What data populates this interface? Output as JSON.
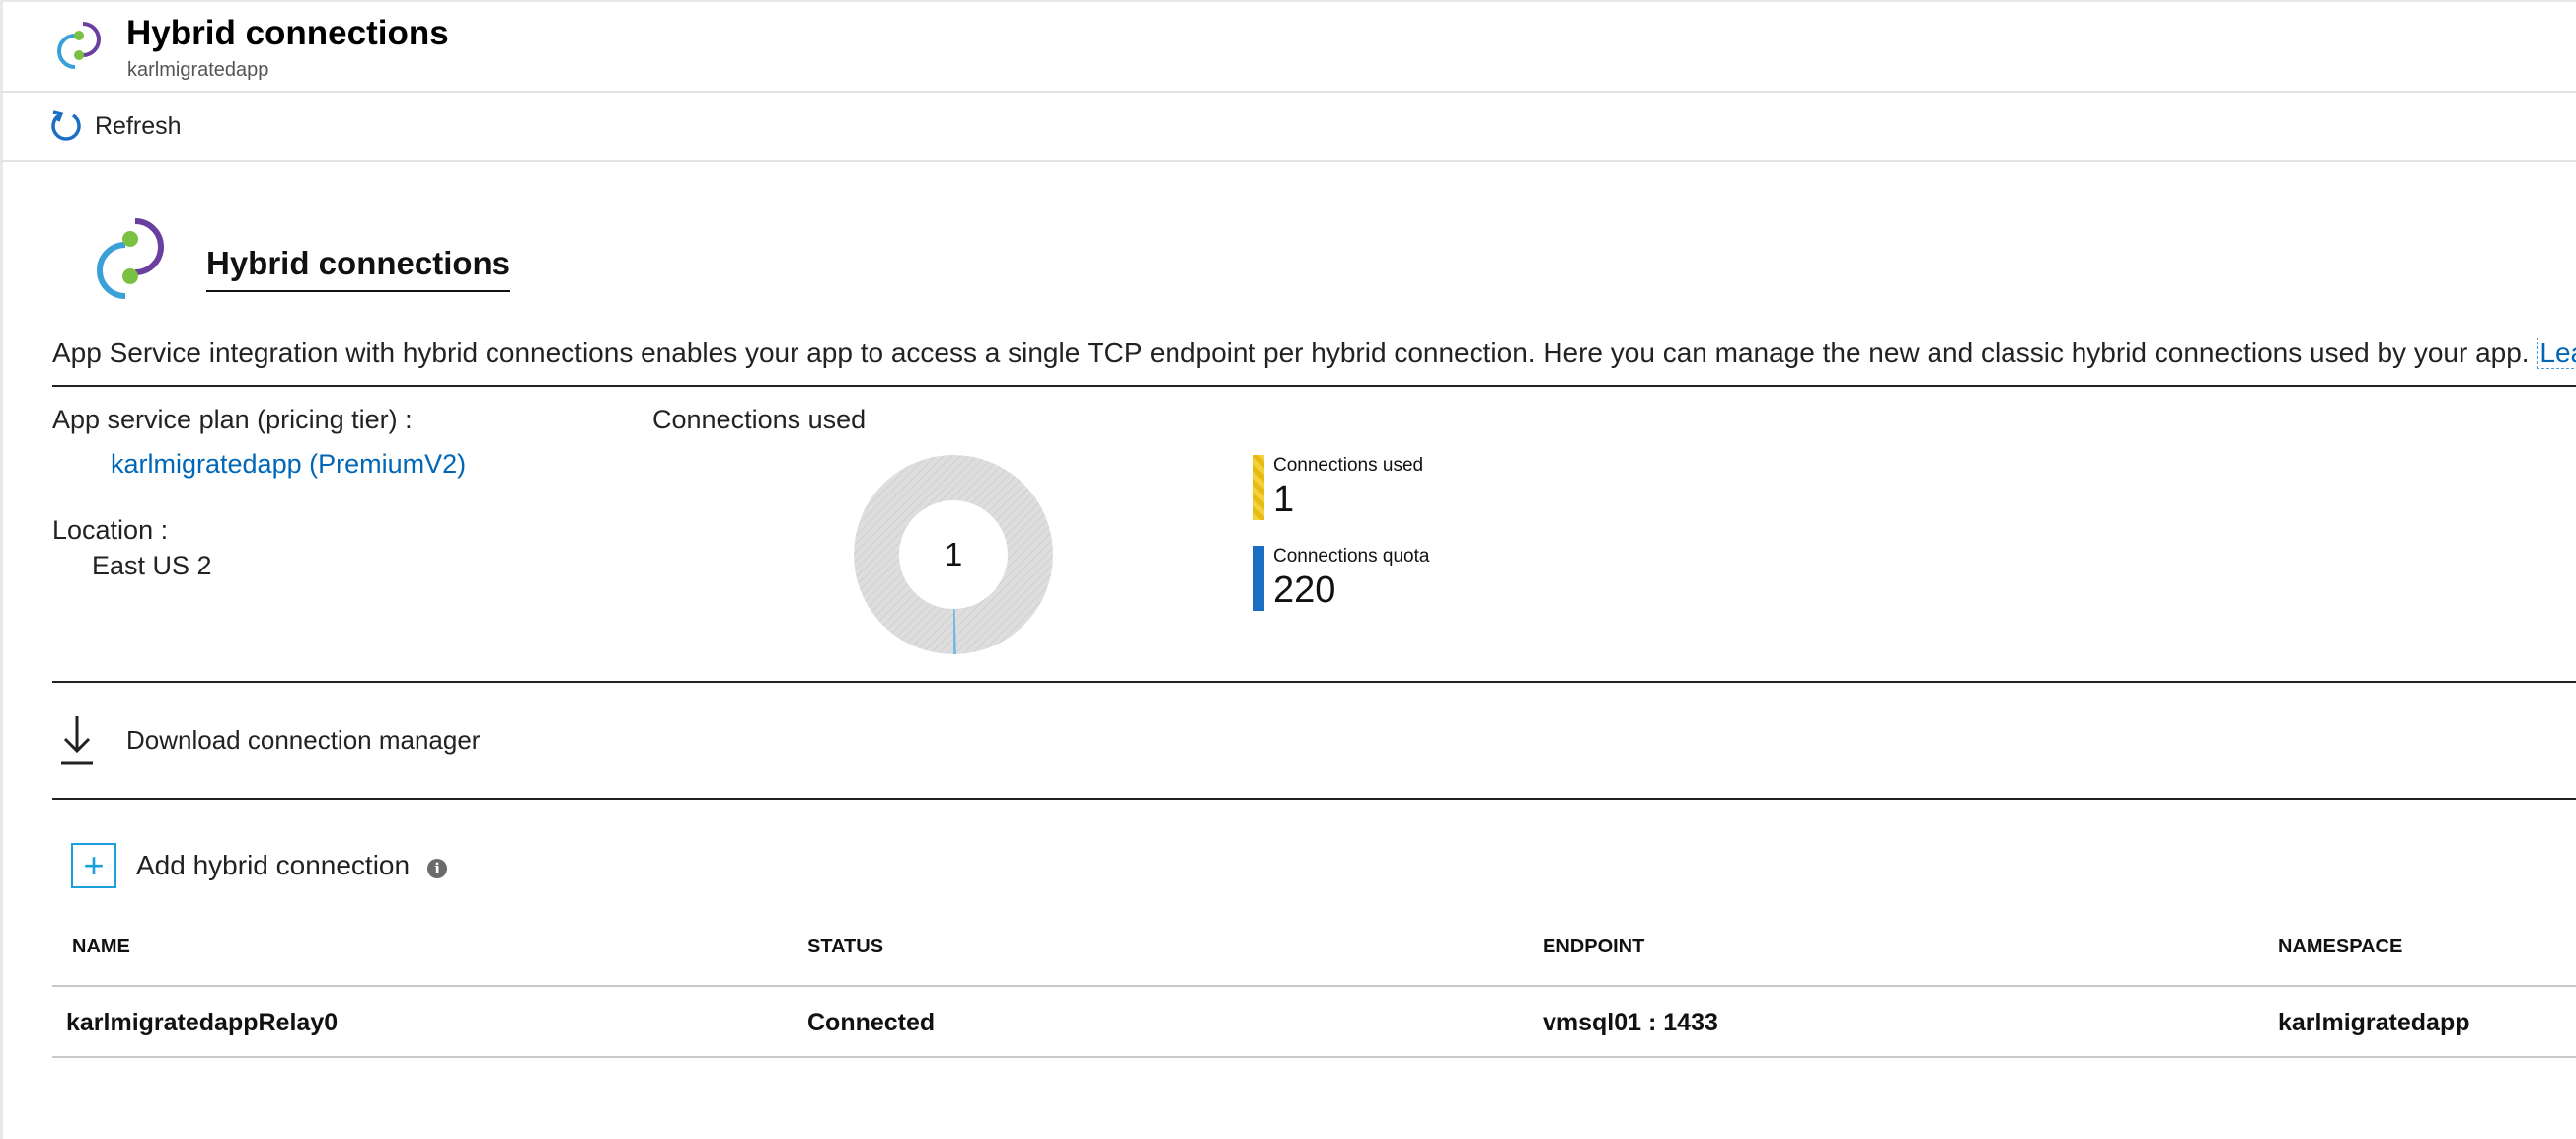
{
  "header": {
    "title": "Hybrid connections",
    "subtitle": "karlmigratedapp"
  },
  "toolbar": {
    "refresh_label": "Refresh"
  },
  "hero": {
    "title": "Hybrid connections"
  },
  "description": {
    "text": "App Service integration with hybrid connections enables your app to access a single TCP endpoint per hybrid connection. Here you can manage the new and classic hybrid connections used by your app. ",
    "link_text": "Learn more"
  },
  "info": {
    "plan_label": "App service plan (pricing tier) :",
    "plan_value": "karlmigratedapp (PremiumV2)",
    "location_label": "Location :",
    "location_value": "East US 2"
  },
  "connections": {
    "title": "Connections used",
    "center_value": "1",
    "used": 1,
    "quota": 220,
    "legend": [
      {
        "label": "Connections used",
        "value": "1",
        "color": "#f2d13a"
      },
      {
        "label": "Connections quota",
        "value": "220",
        "color": "#1a6fc4"
      }
    ]
  },
  "actions": {
    "download_label": "Download connection manager",
    "add_label": "Add hybrid connection"
  },
  "table": {
    "headers": [
      "NAME",
      "STATUS",
      "ENDPOINT",
      "NAMESPACE"
    ],
    "rows": [
      [
        "karlmigratedappRelay0",
        "Connected",
        "vmsql01 : 1433",
        "karlmigratedapp"
      ]
    ]
  },
  "colors": {
    "link": "#0067b8",
    "accent": "#1aa0dd",
    "used": "#f2d13a",
    "quota": "#1a6fc4",
    "donut_track": "#dcdcdc"
  },
  "icons": [
    "hybrid-connections-icon",
    "refresh-icon",
    "download-icon",
    "plus-icon",
    "info-icon"
  ]
}
